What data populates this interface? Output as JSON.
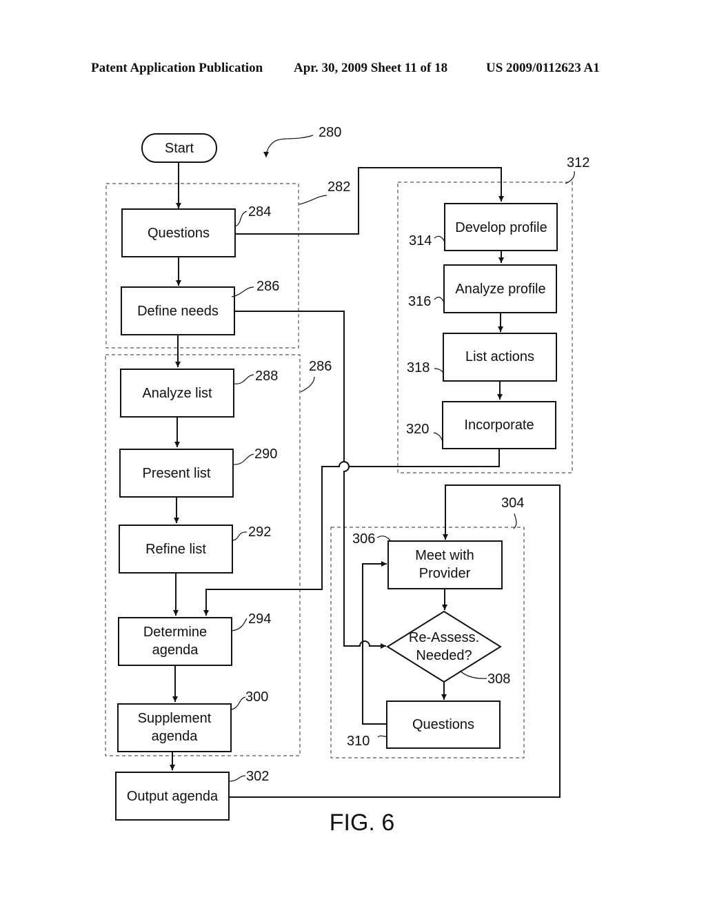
{
  "header": {
    "publication": "Patent Application Publication",
    "date_sheet": "Apr. 30, 2009  Sheet 11 of 18",
    "patent_number": "US 2009/0112623 A1"
  },
  "figure": {
    "caption": "FIG. 6",
    "reference": "280"
  },
  "groups": [
    {
      "id": "g282",
      "ref": "282",
      "contains": [
        "start_questions",
        "define_needs"
      ]
    },
    {
      "id": "g286b",
      "ref": "286",
      "contains": [
        "analyze_list",
        "present_list",
        "refine_list",
        "determine_agenda",
        "supplement_agenda"
      ]
    },
    {
      "id": "g312",
      "ref": "312",
      "contains": [
        "develop_profile",
        "analyze_profile",
        "list_actions",
        "incorporate"
      ]
    },
    {
      "id": "g304",
      "ref": "304",
      "contains": [
        "meet_provider",
        "reassess",
        "questions_b"
      ]
    }
  ],
  "nodes": {
    "start": {
      "label": [
        "Start"
      ],
      "shape": "terminal"
    },
    "questions": {
      "label": [
        "Questions"
      ],
      "ref": "284"
    },
    "define_needs": {
      "label": [
        "Define needs"
      ],
      "ref": "286"
    },
    "analyze_list": {
      "label": [
        "Analyze list"
      ],
      "ref": "288"
    },
    "present_list": {
      "label": [
        "Present list"
      ],
      "ref": "290"
    },
    "refine_list": {
      "label": [
        "Refine list"
      ],
      "ref": "292"
    },
    "determine_agenda": {
      "label": [
        "Determine",
        "agenda"
      ],
      "ref": "294"
    },
    "supplement_agenda": {
      "label": [
        "Supplement",
        "agenda"
      ],
      "ref": "300"
    },
    "output_agenda": {
      "label": [
        "Output agenda"
      ],
      "ref": "302"
    },
    "develop_profile": {
      "label": [
        "Develop profile"
      ],
      "ref": "314"
    },
    "analyze_profile": {
      "label": [
        "Analyze profile"
      ],
      "ref": "316"
    },
    "list_actions": {
      "label": [
        "List actions"
      ],
      "ref": "318"
    },
    "incorporate": {
      "label": [
        "Incorporate"
      ],
      "ref": "320"
    },
    "meet_provider": {
      "label": [
        "Meet with",
        "Provider"
      ],
      "ref": "306"
    },
    "reassess": {
      "label": [
        "Re-Assess.",
        "Needed?"
      ],
      "ref": "308",
      "shape": "decision"
    },
    "questions_b": {
      "label": [
        "Questions"
      ],
      "ref": "310"
    }
  },
  "edges": [
    [
      "start",
      "questions"
    ],
    [
      "questions",
      "define_needs"
    ],
    [
      "questions",
      "develop_profile"
    ],
    [
      "define_needs",
      "analyze_list"
    ],
    [
      "define_needs",
      "reassess"
    ],
    [
      "analyze_list",
      "present_list"
    ],
    [
      "present_list",
      "refine_list"
    ],
    [
      "refine_list",
      "determine_agenda"
    ],
    [
      "incorporate",
      "determine_agenda"
    ],
    [
      "determine_agenda",
      "supplement_agenda"
    ],
    [
      "supplement_agenda",
      "output_agenda"
    ],
    [
      "output_agenda",
      "meet_provider"
    ],
    [
      "develop_profile",
      "analyze_profile"
    ],
    [
      "analyze_profile",
      "list_actions"
    ],
    [
      "list_actions",
      "incorporate"
    ],
    [
      "meet_provider",
      "reassess"
    ],
    [
      "reassess",
      "questions_b"
    ],
    [
      "questions_b",
      "meet_provider"
    ]
  ]
}
